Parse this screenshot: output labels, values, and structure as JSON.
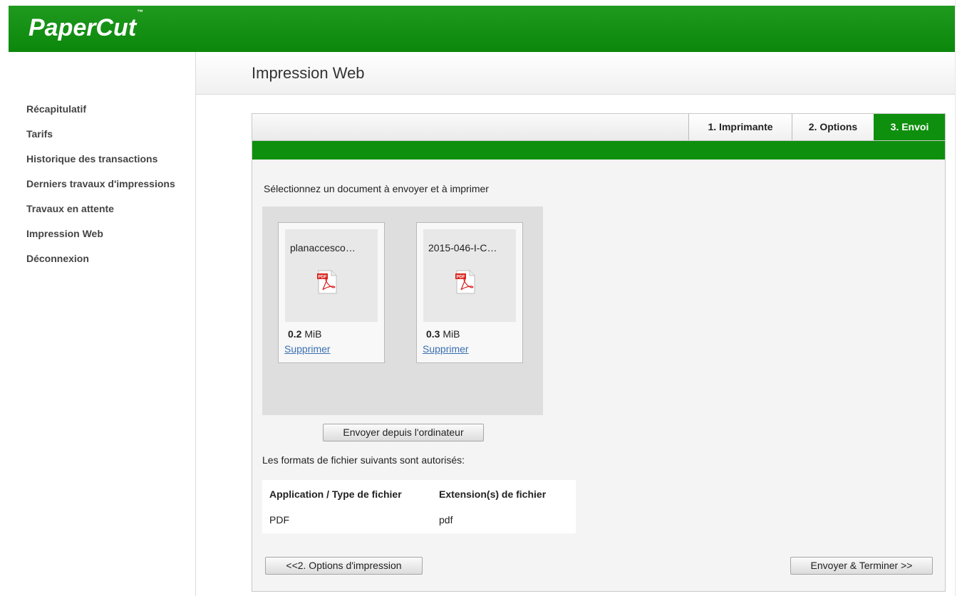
{
  "app": {
    "logo": "PaperCut",
    "logo_tm": "™"
  },
  "sidebar": {
    "items": [
      {
        "label": "Récapitulatif"
      },
      {
        "label": "Tarifs"
      },
      {
        "label": "Historique des transactions"
      },
      {
        "label": "Derniers travaux d'impressions"
      },
      {
        "label": "Travaux en attente"
      },
      {
        "label": "Impression Web"
      },
      {
        "label": "Déconnexion"
      }
    ]
  },
  "page": {
    "title": "Impression Web"
  },
  "steps": [
    {
      "label": "1. Imprimante",
      "active": false
    },
    {
      "label": "2. Options",
      "active": false
    },
    {
      "label": "3. Envoi",
      "active": true
    }
  ],
  "upload": {
    "instruction": "Sélectionnez un document à envoyer et à imprimer",
    "files": [
      {
        "name": "planaccesco…",
        "size_value": "0.2",
        "size_unit": "MiB",
        "remove_label": "Supprimer",
        "icon": "pdf-file-icon"
      },
      {
        "name": "2015-046-I-C…",
        "size_value": "0.3",
        "size_unit": "MiB",
        "remove_label": "Supprimer",
        "icon": "pdf-file-icon"
      }
    ],
    "upload_button": "Envoyer depuis l'ordinateur"
  },
  "formats": {
    "intro": "Les formats de fichier suivants sont autorisés:",
    "headers": [
      "Application / Type de fichier",
      "Extension(s) de fichier"
    ],
    "rows": [
      [
        "PDF",
        "pdf"
      ]
    ]
  },
  "actions": {
    "back": "<<2. Options d'impression",
    "submit": "Envoyer & Terminer >>"
  },
  "colors": {
    "brand_green": "#0e8f0e",
    "link": "#3a6fb0"
  }
}
